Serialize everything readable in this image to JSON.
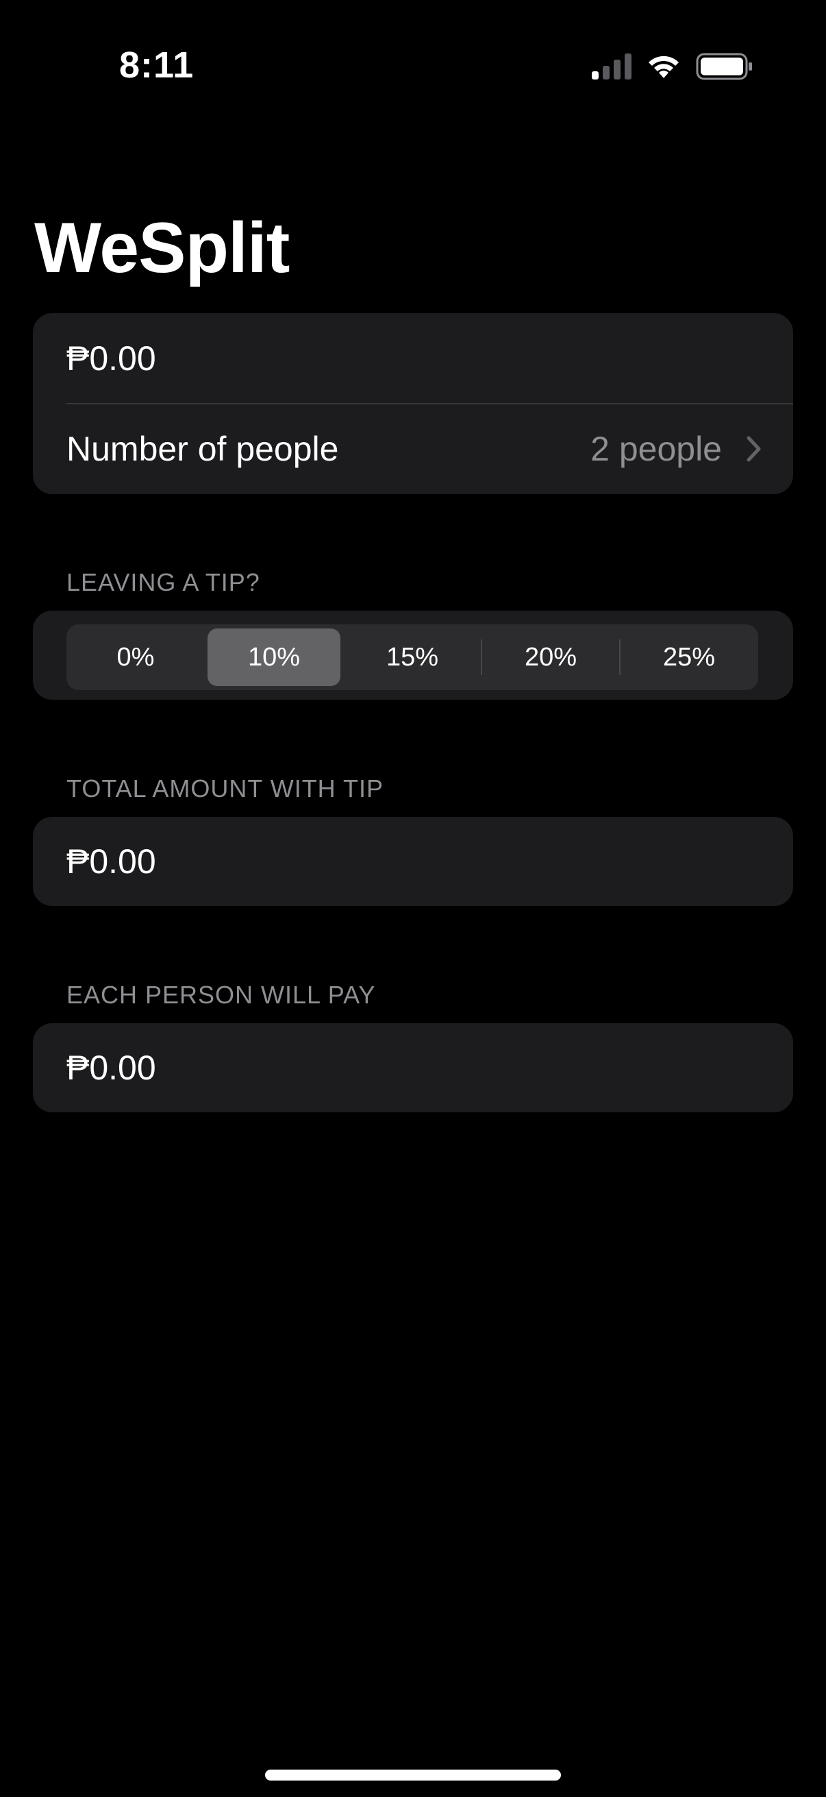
{
  "status_bar": {
    "time": "8:11"
  },
  "app": {
    "title": "WeSplit"
  },
  "form": {
    "amount_placeholder": "₱0.00",
    "people_label": "Number of people",
    "people_value": "2 people"
  },
  "tip_section": {
    "header": "LEAVING A TIP?",
    "options": [
      "0%",
      "10%",
      "15%",
      "20%",
      "25%"
    ],
    "selected": "10%"
  },
  "total_section": {
    "header": "TOTAL AMOUNT WITH TIP",
    "value": "₱0.00"
  },
  "per_person_section": {
    "header": "EACH PERSON WILL PAY",
    "value": "₱0.00"
  },
  "colors": {
    "background": "#000000",
    "card": "#1c1c1e",
    "secondary_text": "#8e8e93",
    "segment_selected": "#636366"
  },
  "icons": {
    "signal": "cellular-signal-icon",
    "wifi": "wifi-icon",
    "battery": "battery-icon",
    "chevron": "chevron-right-icon"
  }
}
